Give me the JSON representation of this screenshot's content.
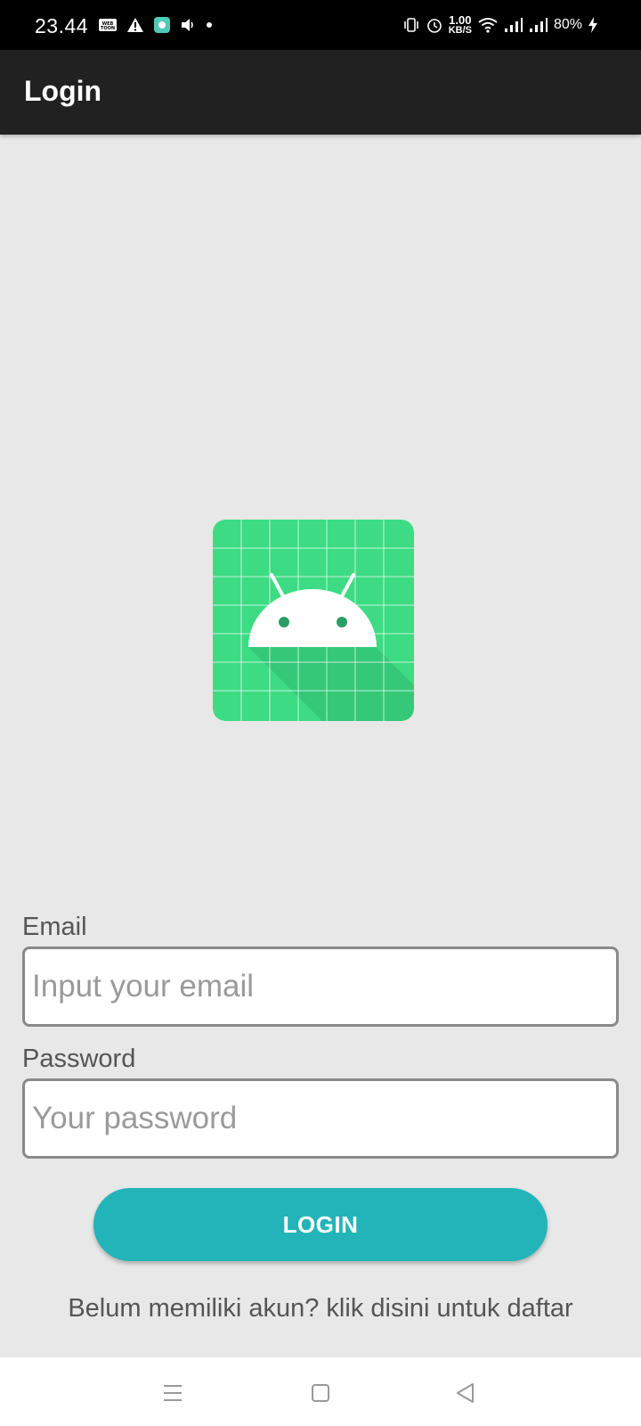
{
  "status_bar": {
    "time": "23.44",
    "net_speed_value": "1.00",
    "net_speed_unit": "KB/S",
    "battery": "80%",
    "left_icons": [
      "webtoon-icon",
      "warning-icon",
      "app-notification-icon",
      "volume-icon",
      "dot-icon"
    ],
    "right_icons": [
      "vibrate-icon",
      "alarm-icon",
      "wifi-icon",
      "signal-icon",
      "signal-icon",
      "charging-icon"
    ]
  },
  "app_bar": {
    "title": "Login"
  },
  "logo": {
    "icon": "android-logo-icon",
    "background_color": "#3ddc84"
  },
  "form": {
    "email_label": "Email",
    "email_placeholder": "Input your email",
    "email_value": "",
    "password_label": "Password",
    "password_placeholder": "Your password",
    "password_value": "",
    "login_button": "LOGIN",
    "register_text": "Belum memiliki akun? klik disini untuk daftar"
  },
  "nav_bar": {
    "buttons": [
      "menu-icon",
      "home-icon",
      "back-icon"
    ]
  },
  "colors": {
    "accent": "#22b4b8",
    "app_bar": "#212121",
    "background": "#e8e8e8"
  }
}
